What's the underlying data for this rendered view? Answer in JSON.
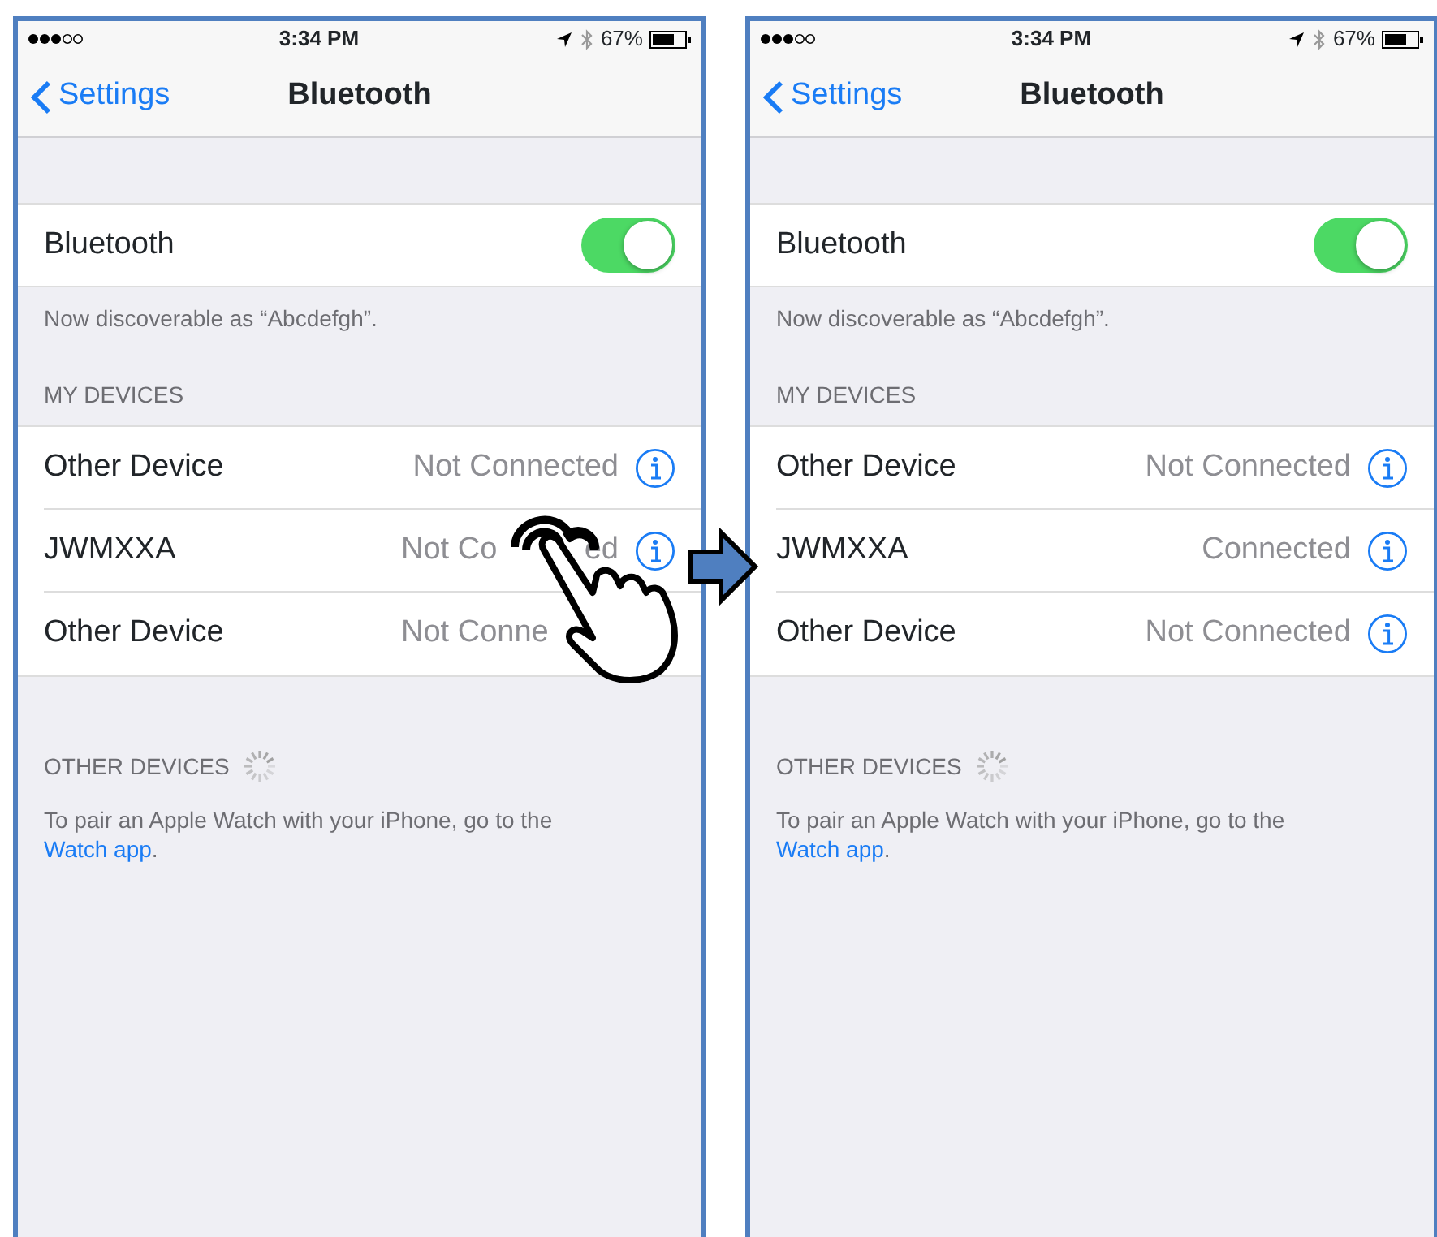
{
  "screens": [
    {
      "status_bar": {
        "time": "3:34 PM",
        "battery": "67%"
      },
      "nav": {
        "back": "Settings",
        "title": "Bluetooth"
      },
      "bluetooth": {
        "label": "Bluetooth",
        "on": true
      },
      "discoverable": "Now discoverable as “Abcdefgh”.",
      "my_devices_header": "MY DEVICES",
      "devices": [
        {
          "name": "Other Device",
          "status_parts": [
            "Not Connected"
          ],
          "cut": false,
          "info_icon": true
        },
        {
          "name": "JWMXXA",
          "status_parts": [
            "Not Co",
            "ed"
          ],
          "cut": true,
          "info_icon": true
        },
        {
          "name": "Other Device",
          "status_parts": [
            "Not Conne"
          ],
          "cut": true,
          "info_icon": false
        }
      ],
      "other_devices_header": "OTHER DEVICES",
      "pair_text": "To pair an Apple Watch with your iPhone, go to the",
      "pair_link": "Watch app",
      "pair_end": ".",
      "tap_gesture": true
    },
    {
      "status_bar": {
        "time": "3:34 PM",
        "battery": "67%"
      },
      "nav": {
        "back": "Settings",
        "title": "Bluetooth"
      },
      "bluetooth": {
        "label": "Bluetooth",
        "on": true
      },
      "discoverable": "Now discoverable as “Abcdefgh”.",
      "my_devices_header": "MY DEVICES",
      "devices": [
        {
          "name": "Other Device",
          "status_parts": [
            "Not Connected"
          ],
          "cut": false,
          "info_icon": true
        },
        {
          "name": "JWMXXA",
          "status_parts": [
            "Connected"
          ],
          "cut": false,
          "info_icon": true
        },
        {
          "name": "Other Device",
          "status_parts": [
            "Not Connected"
          ],
          "cut": false,
          "info_icon": true
        }
      ],
      "other_devices_header": "OTHER DEVICES",
      "pair_text": "To pair an Apple Watch with your iPhone, go to the",
      "pair_link": "Watch app",
      "pair_end": ".",
      "tap_gesture": false
    }
  ]
}
